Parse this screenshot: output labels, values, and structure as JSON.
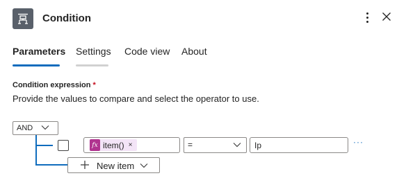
{
  "header": {
    "title": "Condition",
    "icon": "condition-icon",
    "more_icon": "more-vertical-icon",
    "close_icon": "close-icon"
  },
  "tabs": [
    {
      "label": "Parameters",
      "active": true
    },
    {
      "label": "Settings",
      "active": false
    },
    {
      "label": "Code view",
      "active": false
    },
    {
      "label": "About",
      "active": false
    }
  ],
  "condition": {
    "label": "Condition expression",
    "required_mark": "*",
    "description": "Provide the values to compare and select the operator to use.",
    "group_operator": "AND",
    "rows": [
      {
        "left_token_label": "item()",
        "left_token_icon": "fx-icon",
        "left_token_remove": "×",
        "operator": "=",
        "right_value": "Ip",
        "more_label": "···"
      }
    ],
    "new_item_label": "New item"
  },
  "colors": {
    "accent": "#0f6cbd",
    "token_bg": "#f3e4f7",
    "token_icon_bg": "#b0338f",
    "header_icon_bg": "#59606a",
    "required": "#c50f1f"
  }
}
